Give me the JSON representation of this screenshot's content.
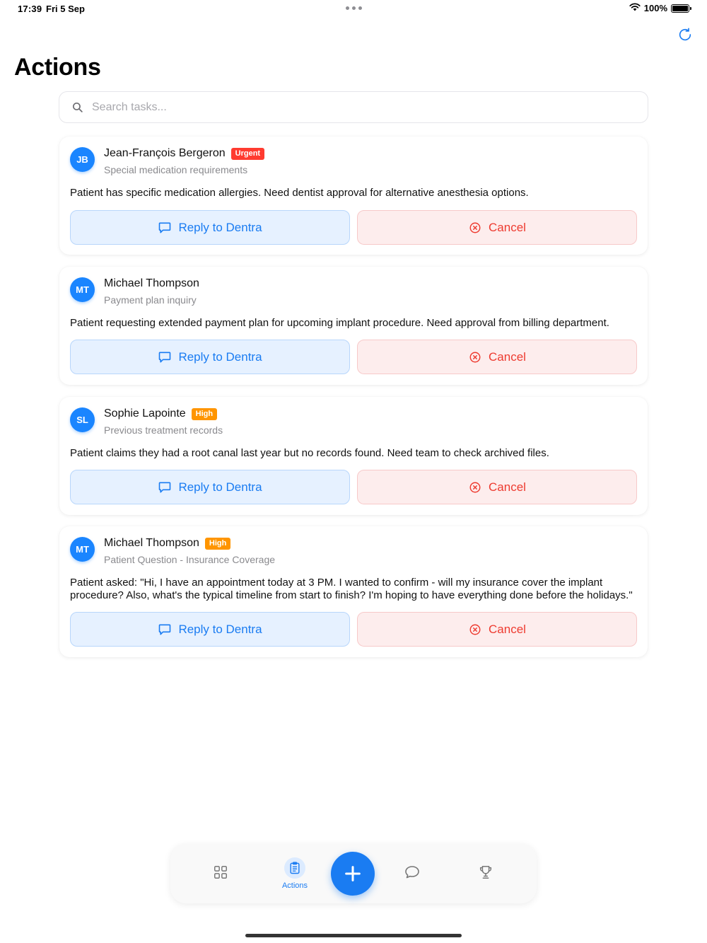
{
  "status_bar": {
    "time": "17:39",
    "date": "Fri 5 Sep",
    "battery": "100%"
  },
  "page_title": "Actions",
  "search": {
    "placeholder": "Search tasks...",
    "value": ""
  },
  "cards": [
    {
      "initials": "JB",
      "name": "Jean-François Bergeron",
      "badge": "Urgent",
      "subtitle": "Special medication requirements",
      "message": "Patient has specific medication allergies. Need dentist approval for alternative anesthesia options.",
      "reply_label": "Reply to Dentra",
      "cancel_label": "Cancel"
    },
    {
      "initials": "MT",
      "name": "Michael Thompson",
      "badge": "",
      "subtitle": "Payment plan inquiry",
      "message": "Patient requesting extended payment plan for upcoming implant procedure. Need approval from billing department.",
      "reply_label": "Reply to Dentra",
      "cancel_label": "Cancel"
    },
    {
      "initials": "SL",
      "name": "Sophie Lapointe",
      "badge": "High",
      "subtitle": "Previous treatment records",
      "message": "Patient claims they had a root canal last year but no records found. Need team to check archived files.",
      "reply_label": "Reply to Dentra",
      "cancel_label": "Cancel"
    },
    {
      "initials": "MT",
      "name": "Michael Thompson",
      "badge": "High",
      "subtitle": "Patient Question - Insurance Coverage",
      "message": "Patient asked: \"Hi, I have an appointment today at 3 PM. I wanted to confirm - will my insurance cover the implant procedure? Also, what's the typical timeline from start to finish? I'm hoping to have everything done before the holidays.\"",
      "reply_label": "Reply to Dentra",
      "cancel_label": "Cancel"
    }
  ],
  "tab_bar": {
    "active_label": "Actions",
    "icons": [
      "grid-icon",
      "clipboard-icon",
      "plus-icon",
      "chat-bubble-icon",
      "trophy-icon"
    ]
  },
  "colors": {
    "accent": "#1a7cf2",
    "urgent": "#ff3b30",
    "high": "#ff9500",
    "cancel": "#ee3b30"
  }
}
